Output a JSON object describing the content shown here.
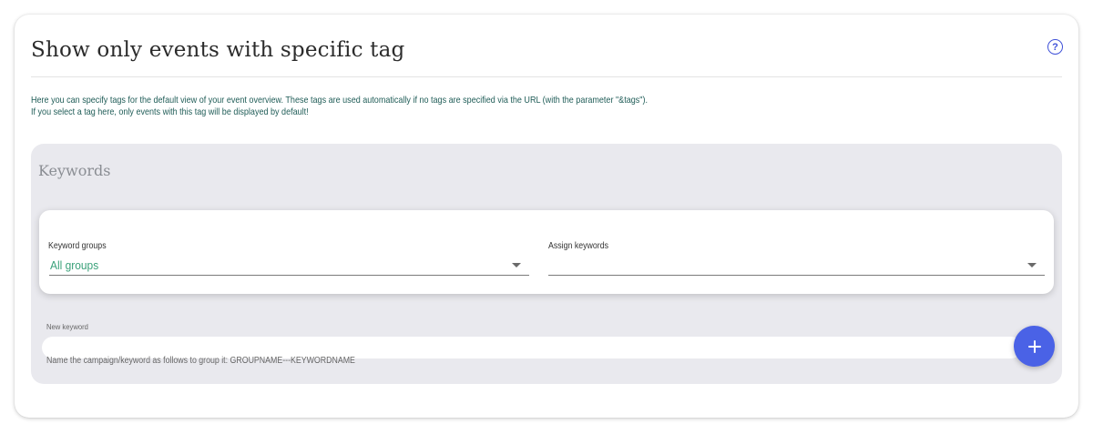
{
  "card": {
    "title": "Show only events with specific tag",
    "help_icon": "question-circle-icon",
    "description": [
      "Here you can specify tags for the default view of your event overview. These tags are used automatically if no tags are specified via the URL (with the parameter \"&tags\").",
      "If you select a tag here, only events with this tag will be displayed by default!"
    ]
  },
  "keywords": {
    "title": "Keywords",
    "keyword_groups": {
      "label": "Keyword groups",
      "value": "All groups"
    },
    "assign_keywords": {
      "label": "Assign keywords",
      "value": ""
    },
    "new_keyword": {
      "label": "New keyword",
      "value": "",
      "placeholder": ""
    },
    "add_button_icon": "plus-icon",
    "hint": "Name the campaign/keyword as follows to group it: GROUPNAME---KEYWORDNAME"
  },
  "colors": {
    "accent": "#4a62e6",
    "help_icon": "#3f51d8",
    "description_text": "#1f5c57",
    "select_value": "#3aa17a",
    "panel_bg": "#e9e9ee"
  }
}
